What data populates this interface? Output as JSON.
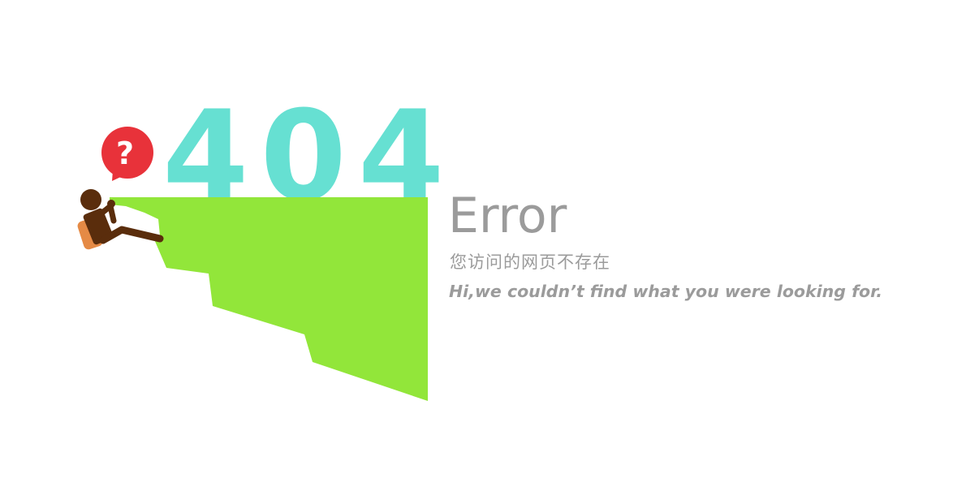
{
  "error_page": {
    "code": "404",
    "question_mark": "?",
    "title": "Error",
    "message_cn": "您访问的网页不存在",
    "message_en": "Hi,we couldn’t find what you were looking for."
  },
  "colors": {
    "code": "#66e0d2",
    "cliff": "#92e63a",
    "bubble": "#e8323a",
    "figure": "#5a2d0c",
    "backpack": "#e58a45",
    "text": "#9b9b9b",
    "background": "#ffffff"
  },
  "icons": {
    "bubble": "question-speech-bubble-icon",
    "figure": "climbing-person-icon"
  }
}
